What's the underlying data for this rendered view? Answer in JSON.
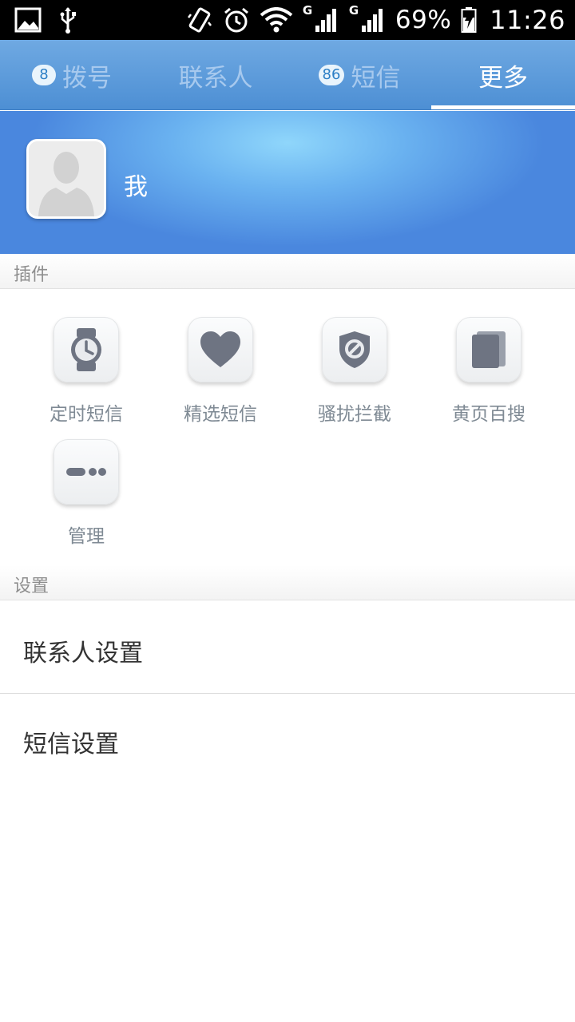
{
  "status_bar": {
    "battery": "69%",
    "time": "11:26",
    "signal_1_type": "G",
    "signal_2_type": "G",
    "icons": [
      "image-icon",
      "usb-icon",
      "vibrate-icon",
      "alarm-icon",
      "wifi-icon",
      "signal-icon",
      "signal-icon",
      "battery-charging-icon"
    ]
  },
  "tabs": [
    {
      "label": "拨号",
      "badge": "8",
      "active": false
    },
    {
      "label": "联系人",
      "badge": "",
      "active": false
    },
    {
      "label": "短信",
      "badge": "86",
      "active": false
    },
    {
      "label": "更多",
      "badge": "",
      "active": true
    }
  ],
  "profile": {
    "name": "我",
    "avatar_icon": "default-avatar-icon"
  },
  "plugins_section": {
    "title": "插件",
    "items": [
      {
        "label": "定时短信",
        "icon": "watch-icon"
      },
      {
        "label": "精选短信",
        "icon": "heart-icon"
      },
      {
        "label": "骚扰拦截",
        "icon": "shield-block-icon"
      },
      {
        "label": "黄页百搜",
        "icon": "book-icon"
      },
      {
        "label": "管理",
        "icon": "more-dots-icon"
      }
    ]
  },
  "settings_section": {
    "title": "设置",
    "items": [
      {
        "label": "联系人设置"
      },
      {
        "label": "短信设置"
      }
    ]
  },
  "colors": {
    "tab_bar": "#5a9ad9",
    "tab_active_text": "#ffffff",
    "tab_inactive_text": "#a7c9ee",
    "icon_gray": "#6e7482"
  }
}
